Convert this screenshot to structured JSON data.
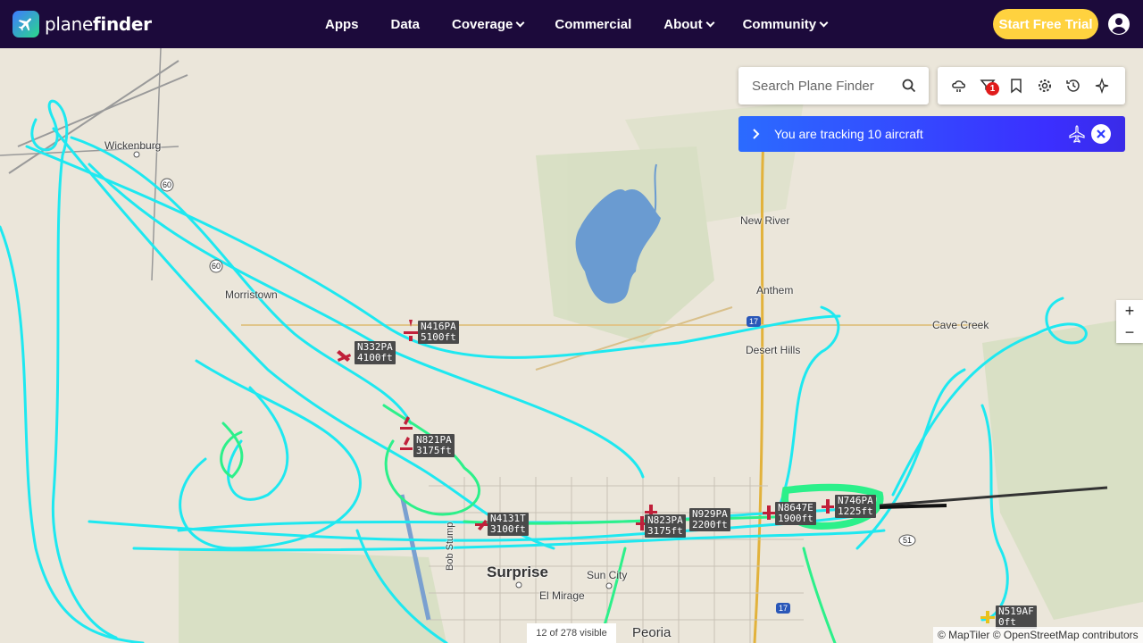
{
  "brand": {
    "name_light": "plane",
    "name_bold": "finder"
  },
  "nav": [
    {
      "label": "Apps",
      "dropdown": false
    },
    {
      "label": "Data",
      "dropdown": false
    },
    {
      "label": "Coverage",
      "dropdown": true
    },
    {
      "label": "Commercial",
      "dropdown": false
    },
    {
      "label": "About",
      "dropdown": true
    },
    {
      "label": "Community",
      "dropdown": true
    }
  ],
  "cta": {
    "label": "Start Free Trial"
  },
  "search": {
    "placeholder": "Search Plane Finder"
  },
  "toolbar": {
    "icons": [
      "weather-icon",
      "filter-icon",
      "bookmark-icon",
      "settings-icon",
      "history-icon",
      "playback-icon"
    ],
    "filter_badge": "1"
  },
  "tracking": {
    "text": "You are tracking 10 aircraft"
  },
  "zoom": {
    "in": "+",
    "out": "−"
  },
  "status": {
    "visible": "12 of 278 visible"
  },
  "attribution": "© MapTiler © OpenStreetMap contributors",
  "places": [
    {
      "name": "Wickenburg"
    },
    {
      "name": "New River"
    },
    {
      "name": "Anthem"
    },
    {
      "name": "Desert Hills"
    },
    {
      "name": "Cave Creek"
    },
    {
      "name": "Surprise"
    },
    {
      "name": "Sun City"
    },
    {
      "name": "El Mirage"
    },
    {
      "name": "Peoria"
    },
    {
      "name": "Bob Stump"
    },
    {
      "name": "Morristown"
    }
  ],
  "aircraft": [
    {
      "reg": "N416PA",
      "alt": "5100ft"
    },
    {
      "reg": "N332PA",
      "alt": "4100ft"
    },
    {
      "reg": "N821PA",
      "alt": "3175ft"
    },
    {
      "reg": "N4131T",
      "alt": "3100ft"
    },
    {
      "reg": "N823PA",
      "alt": "3175ft"
    },
    {
      "reg": "N929PA",
      "alt": "2200ft"
    },
    {
      "reg": "N8647E",
      "alt": "1900ft"
    },
    {
      "reg": "N746PA",
      "alt": "1225ft"
    },
    {
      "reg": "N519AF",
      "alt": "0ft"
    }
  ],
  "colors": {
    "topbar": "#1c0a3b",
    "cta": "#ffd23f",
    "track_cyan": "#1ee8f0",
    "track_green": "#2cf08a",
    "aircraft": "#c0203a",
    "tracking_bar": "#3b2fff"
  }
}
